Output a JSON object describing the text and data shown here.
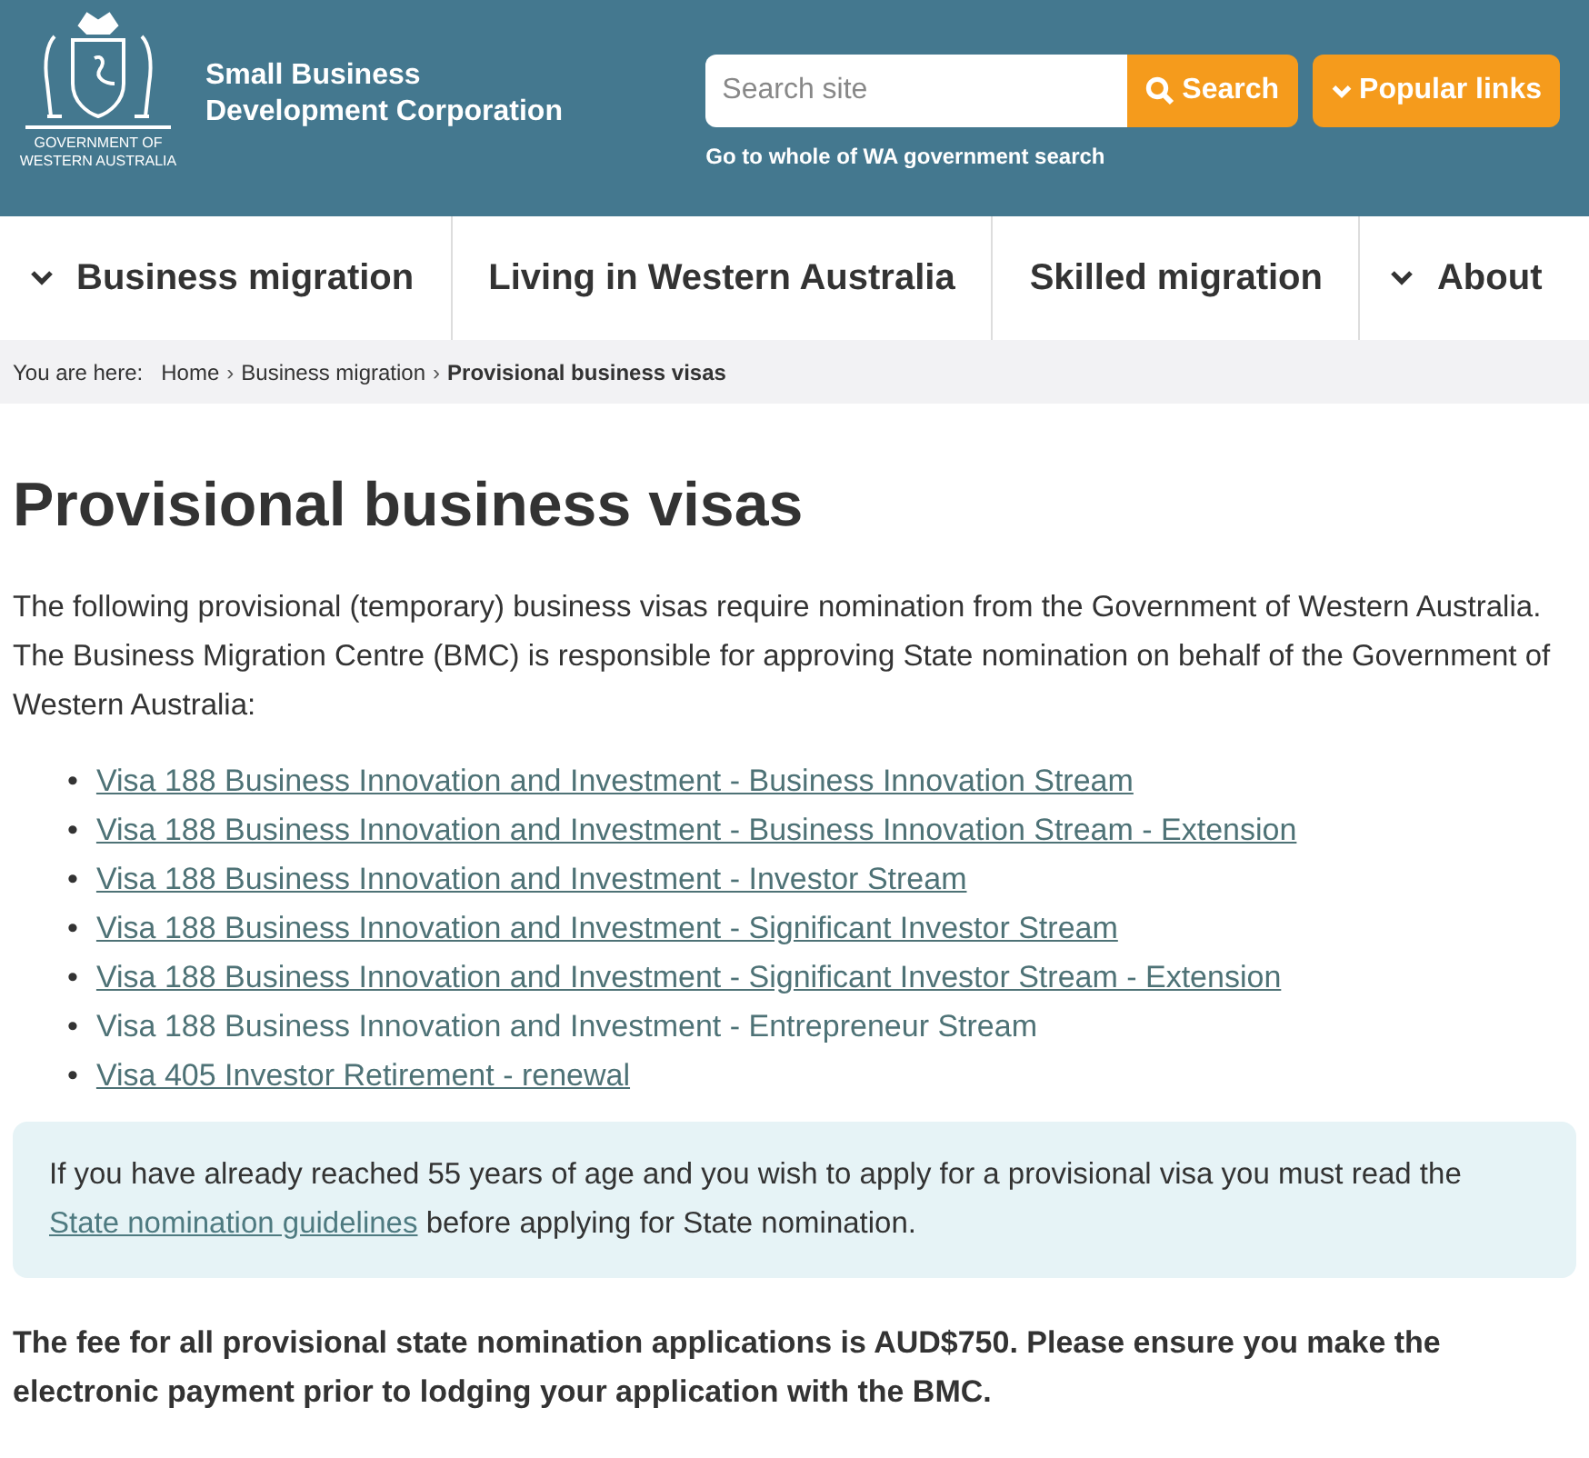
{
  "header": {
    "logo_caption_lines": [
      "GOVERNMENT OF",
      "WESTERN AUSTRALIA"
    ],
    "org_name_lines": [
      "Small Business",
      "Development Corporation"
    ],
    "search": {
      "placeholder": "Search site",
      "button": "Search",
      "popular_button": "Popular links",
      "whole_of_gov_link": "Go to whole of WA government search"
    }
  },
  "nav": [
    {
      "label": "Business migration",
      "expandable": true
    },
    {
      "label": "Living in Western Australia",
      "expandable": false
    },
    {
      "label": "Skilled migration",
      "expandable": false
    },
    {
      "label": "About",
      "expandable": true
    }
  ],
  "breadcrumb": {
    "prefix": "You are here:",
    "separator": "›",
    "items": [
      {
        "label": "Home",
        "current": false
      },
      {
        "label": "Business migration",
        "current": false
      },
      {
        "label": "Provisional business visas",
        "current": true
      }
    ]
  },
  "title": "Provisional business visas",
  "intro": "The following provisional (temporary) business visas require nomination from the Government of Western Australia. The Business Migration Centre (BMC) is responsible for approving State nomination on behalf of the Government of Western Australia:",
  "list_marker": "•",
  "visa_links": [
    {
      "label": "Visa 188 Business Innovation and Investment - Business Innovation Stream",
      "underlined": true
    },
    {
      "label": "Visa 188 Business Innovation and Investment - Business Innovation Stream - Extension",
      "underlined": true
    },
    {
      "label": "Visa 188 Business Innovation and Investment - Investor Stream",
      "underlined": true
    },
    {
      "label": "Visa 188 Business Innovation and Investment - Significant Investor Stream",
      "underlined": true
    },
    {
      "label": "Visa 188 Business Innovation and Investment - Significant Investor Stream - Extension",
      "underlined": true
    },
    {
      "label": "Visa 188 Business Innovation and Investment - Entrepreneur Stream",
      "underlined": false
    },
    {
      "label": "Visa 405 Investor Retirement - renewal",
      "underlined": true
    }
  ],
  "callout": {
    "text_before": "If you have already reached 55 years of age and you wish to apply for a provisional visa you must read the",
    "link": "State nomination guidelines",
    "text_after": "before applying for State nomination."
  },
  "fee_note": "The fee for all provisional state nomination applications is AUD$750. Please ensure you make the electronic payment prior to lodging your application with the BMC."
}
